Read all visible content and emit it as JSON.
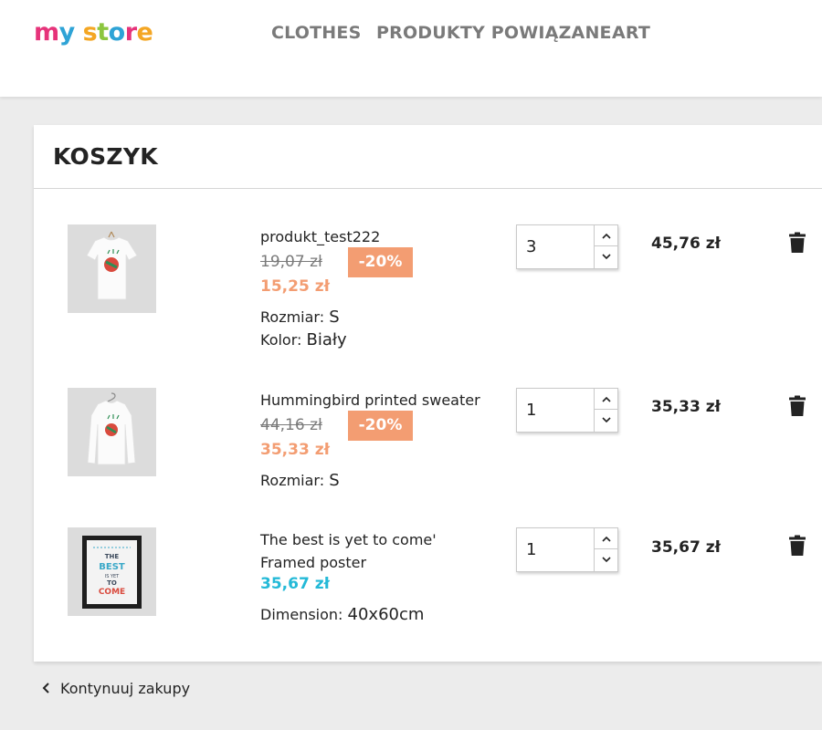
{
  "header": {
    "logo_text": "my store",
    "nav": [
      {
        "label": "CLOTHES"
      },
      {
        "label": "PRODUKTY POWIĄZANE"
      },
      {
        "label": "ART"
      }
    ]
  },
  "cart": {
    "title": "KOSZYK",
    "items": [
      {
        "name_line1": "produkt_test222",
        "name_line2": "",
        "old_price": "19,07 zł",
        "discount": "-20%",
        "price": "15,25 zł",
        "attr1_label": "Rozmiar:",
        "attr1_value": "S",
        "attr2_label": "Kolor:",
        "attr2_value": "Biały",
        "quantity": "3",
        "total": "45,76 zł",
        "thumb_icon": "tshirt-image"
      },
      {
        "name_line1": "Hummingbird printed sweater",
        "name_line2": "",
        "old_price": "44,16 zł",
        "discount": "-20%",
        "price": "35,33 zł",
        "attr1_label": "Rozmiar:",
        "attr1_value": "S",
        "quantity": "1",
        "total": "35,33 zł",
        "thumb_icon": "sweater-image"
      },
      {
        "name_line1": "The best is yet to come'",
        "name_line2": "Framed poster",
        "price": "35,67 zł",
        "attr1_label": "Dimension:",
        "attr1_value": "40x60cm",
        "quantity": "1",
        "total": "35,67 zł",
        "thumb_icon": "framed-poster-image",
        "poster_text": [
          "THE",
          "BEST",
          "IS YET",
          "TO",
          "COME"
        ]
      }
    ]
  },
  "continue_label": "Kontynuuj zakupy",
  "colors": {
    "discount_bg": "#f39d72",
    "discounted_price": "#f39d72",
    "regular_price": "#24b9d7",
    "nav_text": "#7a7a7a"
  }
}
